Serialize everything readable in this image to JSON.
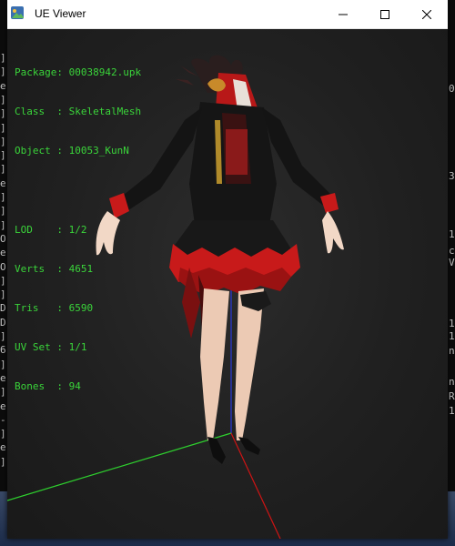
{
  "window": {
    "title": "UE Viewer"
  },
  "info": {
    "package_label": "Package: ",
    "package_value": "00038942.upk",
    "class_label": "Class  : ",
    "class_value": "SkeletalMesh",
    "object_label": "Object : ",
    "object_value": "10053_KunN",
    "lod_label": "LOD    : ",
    "lod_value": "1/2",
    "verts_label": "Verts  : ",
    "verts_value": "4651",
    "tris_label": "Tris   : ",
    "tris_value": "6590",
    "uvset_label": "UV Set : ",
    "uvset_value": "1/1",
    "bones_label": "Bones  : ",
    "bones_value": "94"
  },
  "background_console": {
    "left_chars": [
      "]",
      "]",
      "e",
      "]",
      "]",
      "]",
      "]",
      "]",
      "]",
      "e",
      "]",
      "]",
      "]",
      "O",
      "e",
      "O",
      "]",
      "]",
      "D",
      "D",
      "]",
      "6",
      "]",
      "e",
      "]",
      "e",
      "-",
      "]",
      "e",
      "]"
    ],
    "right_chars": [
      "0",
      "",
      "",
      "3",
      "",
      "1",
      "c",
      "V",
      "",
      "",
      "1",
      "1",
      "n",
      "",
      "n",
      "R",
      "1"
    ]
  },
  "colors": {
    "info_text": "#3ad43a",
    "axis_x": "#d01414",
    "axis_y": "#2ed02e",
    "axis_z": "#2a3ad8",
    "viewport_bg": "#202020"
  },
  "icons": [
    "app-icon",
    "minimize-icon",
    "maximize-icon",
    "close-icon"
  ]
}
